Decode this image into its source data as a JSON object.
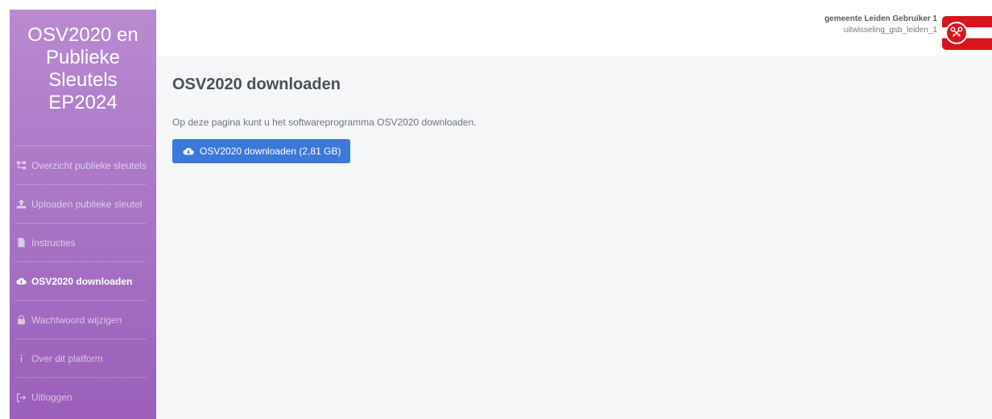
{
  "sidebar": {
    "title": "OSV2020 en Publieke Sleutels EP2024",
    "items": [
      {
        "label": "Overzicht publieke sleutels",
        "icon": "sitemap-icon"
      },
      {
        "label": "Uploaden publieke sleutel",
        "icon": "upload-icon"
      },
      {
        "label": "Instructies",
        "icon": "document-icon"
      },
      {
        "label": "OSV2020 downloaden",
        "icon": "cloud-download-icon",
        "active": true
      },
      {
        "label": "Wachtwoord wijzigen",
        "icon": "lock-icon"
      },
      {
        "label": "Over dit platform",
        "icon": "info-icon"
      },
      {
        "label": "Uitloggen",
        "icon": "logout-icon"
      }
    ]
  },
  "header": {
    "user_name": "gemeente Leiden Gebruiker 1",
    "user_account": "uitwisseling_gsb_leiden_1"
  },
  "main": {
    "title": "OSV2020 downloaden",
    "description": "Op deze pagina kunt u het softwareprogramma OSV2020 downloaden.",
    "button_label": "OSV2020 downloaden (2,81 GB)"
  },
  "colors": {
    "sidebar_top": "#b98ad0",
    "sidebar_bottom": "#9b5fba",
    "primary_button": "#3b78d8",
    "flag_red": "#d8141c"
  }
}
